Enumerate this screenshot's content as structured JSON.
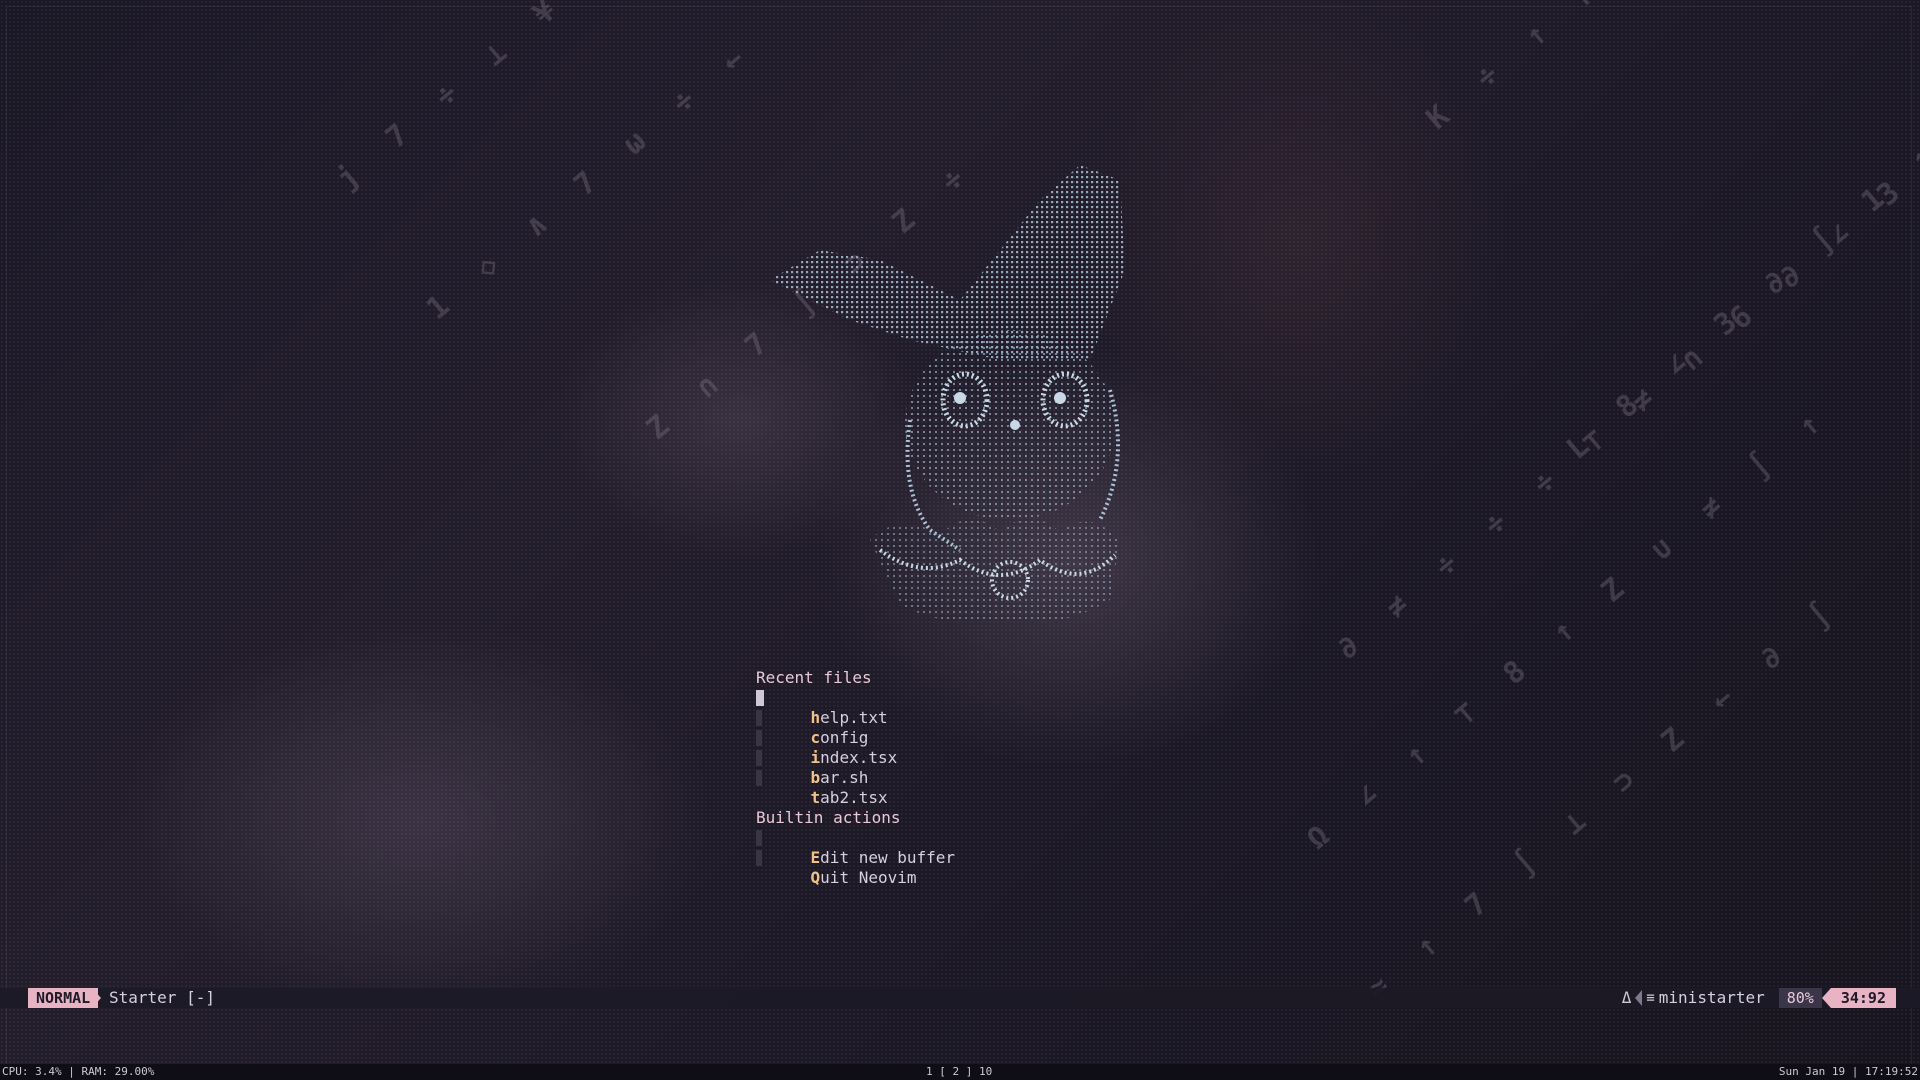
{
  "starter": {
    "sections": [
      {
        "header": "Recent files",
        "items": [
          {
            "hotkey": "h",
            "rest": "elp.txt"
          },
          {
            "hotkey": "c",
            "rest": "onfig"
          },
          {
            "hotkey": "i",
            "rest": "ndex.tsx"
          },
          {
            "hotkey": "b",
            "rest": "ar.sh"
          },
          {
            "hotkey": "t",
            "rest": "ab2.tsx"
          }
        ]
      },
      {
        "header": "Builtin actions",
        "items": [
          {
            "hotkey": "E",
            "rest": "dit new buffer"
          },
          {
            "hotkey": "Q",
            "rest": "uit Neovim"
          }
        ]
      }
    ]
  },
  "statusline": {
    "mode": "NORMAL",
    "file": "Starter [-]",
    "git_icon": "Δ",
    "filetype_icon": "≡",
    "filetype": "ministarter",
    "percent": "80%",
    "position": "34:92"
  },
  "sysbar": {
    "left": "CPU: 3.4% | RAM: 29.00%",
    "workspaces": "1 [ 2 ] 10",
    "datetime": "Sun Jan 19 | 17:19:52"
  },
  "colors": {
    "accent": "#e8b4c4",
    "hotkey": "#f0c28a",
    "header": "#e8c9d8",
    "background": "#15131f",
    "ascii_art": "#a9c0d6"
  },
  "icons": [
    "git-branch-icon",
    "filetype-icon",
    "cursor-block-icon",
    "cat-ascii-art"
  ]
}
